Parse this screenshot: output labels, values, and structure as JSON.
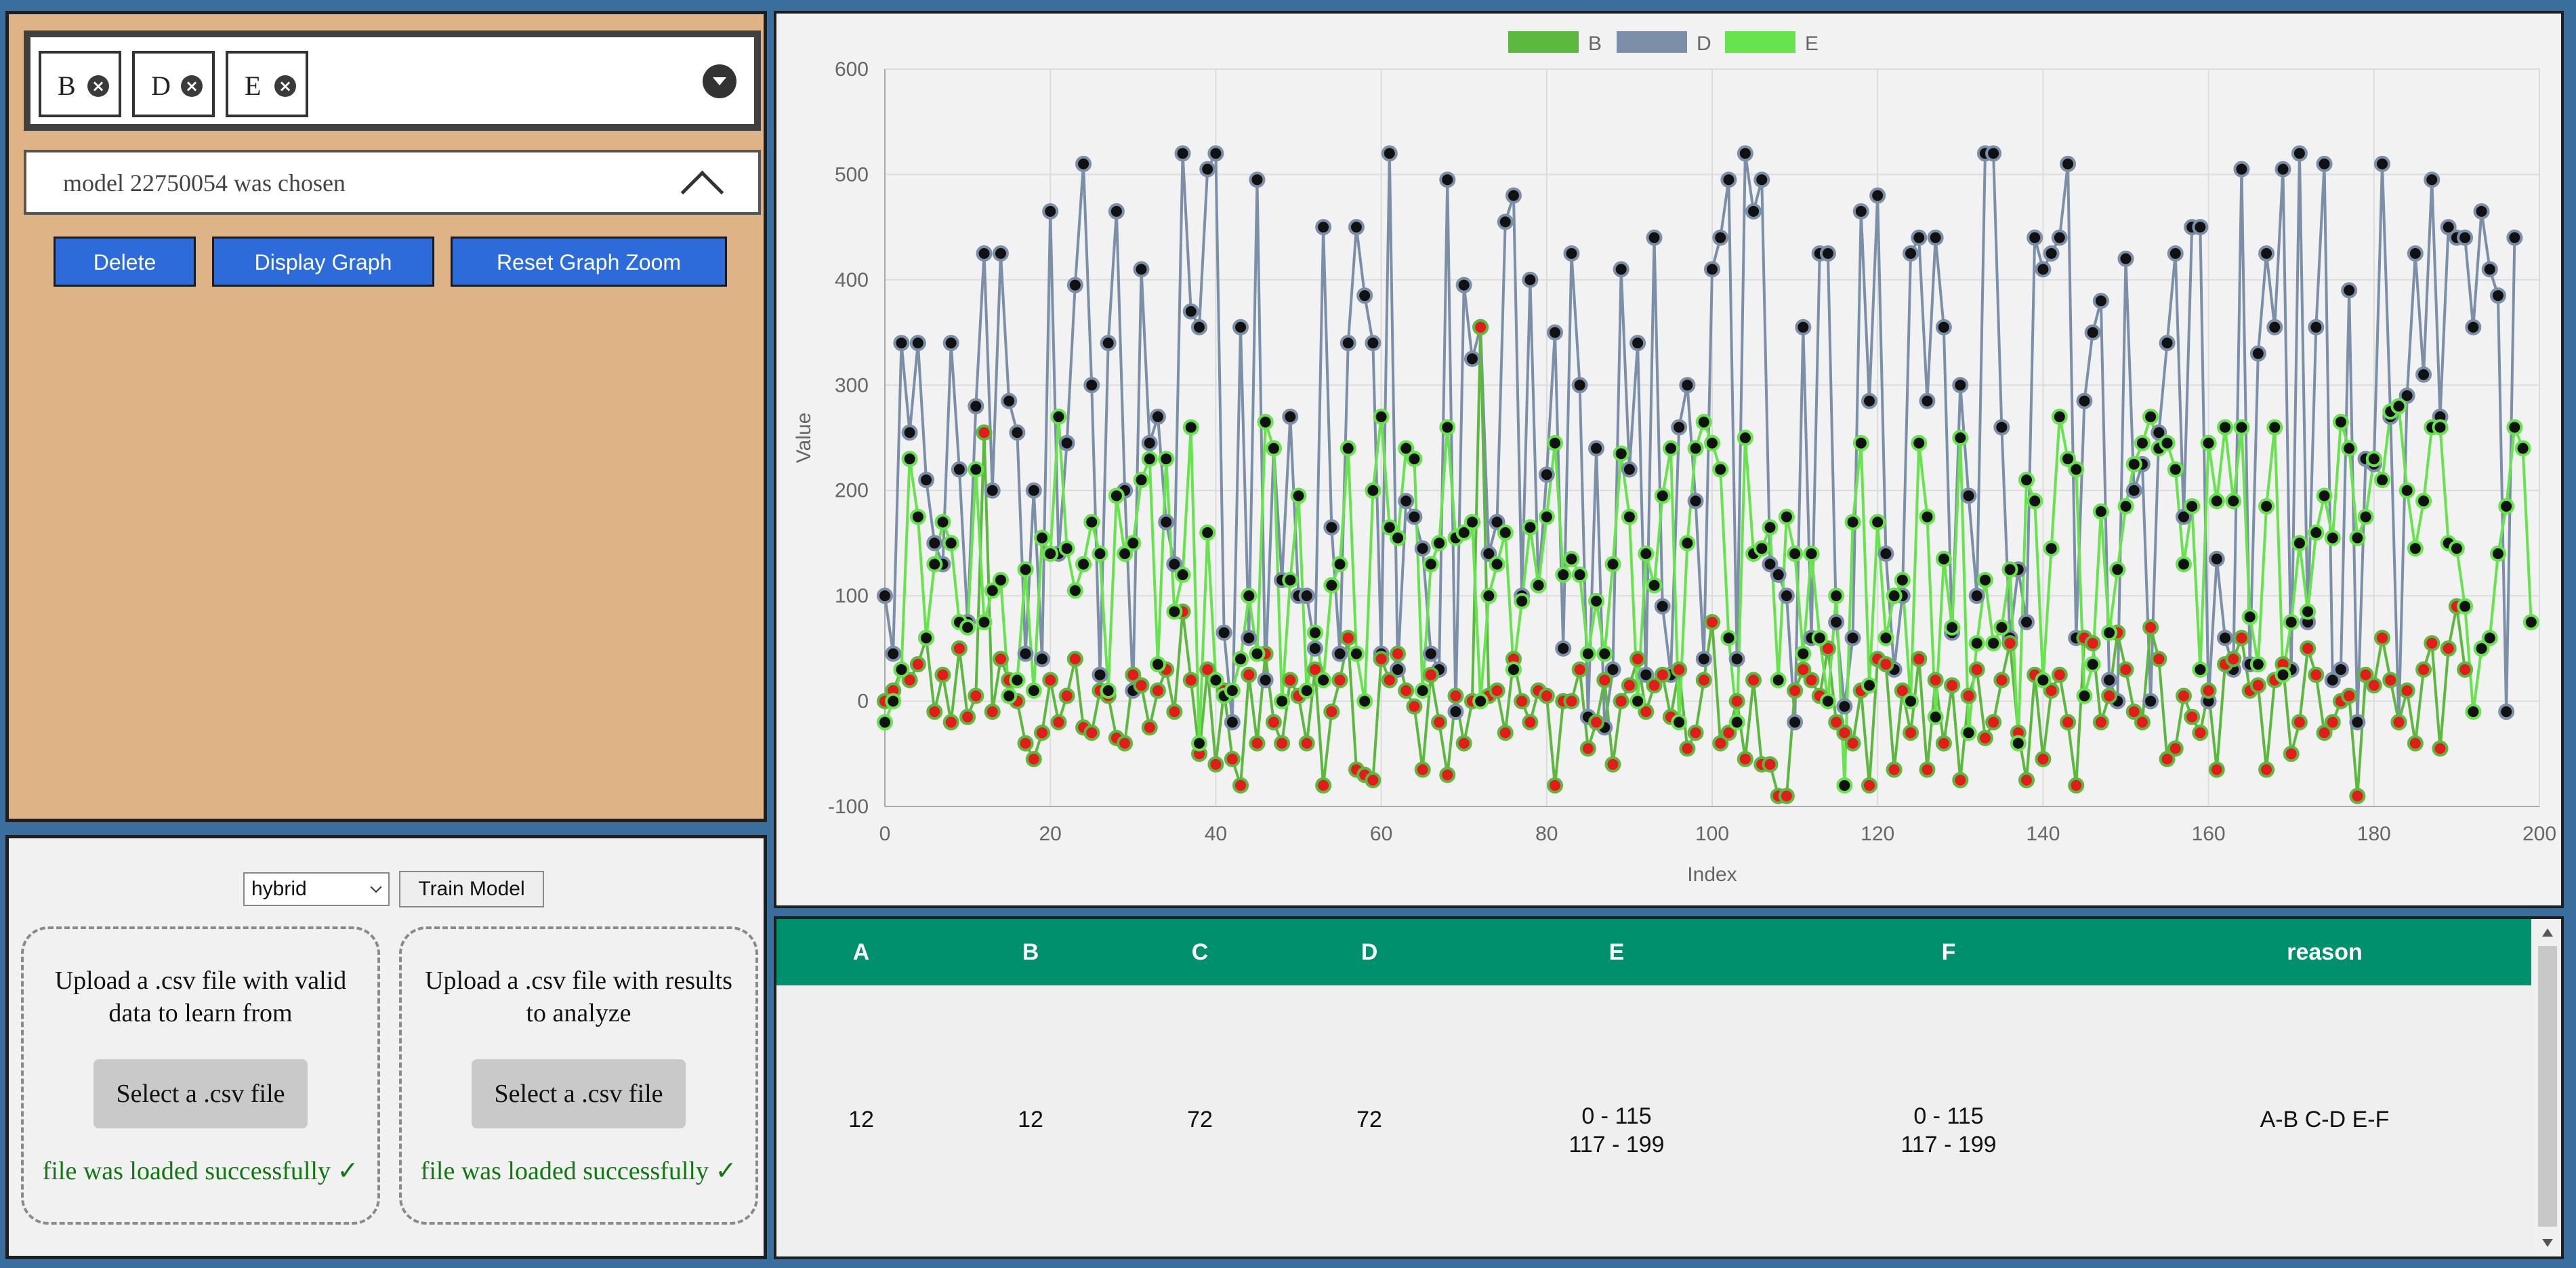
{
  "series_select": {
    "chips": [
      {
        "label": "B"
      },
      {
        "label": "D"
      },
      {
        "label": "E"
      }
    ]
  },
  "model": {
    "status": "model 22750054 was chosen"
  },
  "buttons": {
    "delete": "Delete",
    "display_graph": "Display Graph",
    "reset_zoom": "Reset Graph Zoom"
  },
  "trainer": {
    "model_type": "hybrid",
    "train_label": "Train Model"
  },
  "uploads": [
    {
      "description": "Upload a .csv file with valid data to learn from",
      "button": "Select a .csv file",
      "status": "file was loaded successfully ✓"
    },
    {
      "description": "Upload a .csv file with results to analyze",
      "button": "Select a .csv file",
      "status": "file was loaded successfully ✓"
    }
  ],
  "table": {
    "headers": [
      "A",
      "B",
      "C",
      "D",
      "E",
      "F",
      "reason"
    ],
    "rows": [
      [
        "12",
        "12",
        "72",
        "72",
        "0 - 115\n117 - 199",
        "0 - 115\n117 - 199",
        "A-B C-D E-F"
      ]
    ]
  },
  "chart_data": {
    "type": "line",
    "xlabel": "Index",
    "ylabel": "Value",
    "xlim": [
      0,
      200
    ],
    "ylim": [
      -100,
      600
    ],
    "xticks": [
      0,
      20,
      40,
      60,
      80,
      100,
      120,
      140,
      160,
      180,
      200
    ],
    "yticks": [
      -100,
      0,
      100,
      200,
      300,
      400,
      500,
      600
    ],
    "grid": true,
    "legend_position": "top-center",
    "series": [
      {
        "name": "B",
        "color": "#5cb83f",
        "values": [
          0,
          10,
          30,
          20,
          35,
          60,
          -10,
          25,
          -20,
          50,
          -15,
          5,
          255,
          -10,
          40,
          20,
          0,
          -40,
          -55,
          -30,
          20,
          -20,
          5,
          40,
          -25,
          -30,
          10,
          5,
          -35,
          -40,
          25,
          15,
          -25,
          10,
          30,
          -10,
          85,
          20,
          -50,
          30,
          -60,
          10,
          -55,
          -80,
          25,
          -40,
          45,
          -20,
          -40,
          20,
          5,
          -40,
          30,
          -80,
          -10,
          20,
          60,
          -65,
          -70,
          -75,
          40,
          20,
          45,
          10,
          -5,
          -65,
          25,
          -20,
          -70,
          5,
          -40,
          0,
          355,
          5,
          10,
          -30,
          40,
          0,
          -20,
          10,
          5,
          -80,
          0,
          0,
          30,
          -45,
          -20,
          20,
          -60,
          0,
          15,
          40,
          -10,
          15,
          25,
          -15,
          30,
          -45,
          -30,
          20,
          75,
          -40,
          -30,
          0,
          -55,
          20,
          -60,
          -60,
          -90,
          -90,
          10,
          30,
          20,
          5,
          50,
          -20,
          -30,
          -40,
          10,
          -80,
          40,
          35,
          -65,
          10,
          -30,
          40,
          -65,
          20,
          -40,
          15,
          -75,
          5,
          30,
          -35,
          -20,
          20,
          55,
          -30,
          -75,
          25,
          -55,
          10,
          25,
          -20,
          -80,
          60,
          55,
          -20,
          5,
          65,
          30,
          -10,
          -20,
          70,
          40,
          -55,
          -45,
          5,
          -15,
          -30,
          10,
          -65,
          35,
          40,
          60,
          10,
          15,
          -65,
          20,
          35,
          -50,
          -20,
          50,
          25,
          -30,
          -20,
          0,
          5,
          -90,
          25,
          15,
          60,
          20,
          -20,
          10,
          -40,
          30,
          55,
          -45,
          50,
          90,
          30
        ]
      },
      {
        "name": "D",
        "color": "#7b8fa8",
        "values": [
          100,
          45,
          340,
          255,
          340,
          210,
          150,
          130,
          340,
          220,
          75,
          280,
          425,
          200,
          425,
          285,
          255,
          45,
          200,
          40,
          465,
          140,
          245,
          395,
          510,
          300,
          25,
          340,
          465,
          200,
          10,
          410,
          245,
          270,
          170,
          130,
          520,
          370,
          355,
          505,
          520,
          65,
          -20,
          355,
          60,
          495,
          20,
          240,
          115,
          270,
          100,
          100,
          50,
          450,
          165,
          45,
          340,
          450,
          385,
          340,
          45,
          520,
          30,
          190,
          175,
          145,
          45,
          30,
          495,
          -10,
          395,
          325,
          355,
          140,
          170,
          455,
          480,
          100,
          400,
          110,
          215,
          350,
          50,
          425,
          300,
          -15,
          240,
          -25,
          30,
          410,
          220,
          340,
          25,
          440,
          90,
          25,
          260,
          300,
          190,
          40,
          410,
          440,
          495,
          40,
          520,
          465,
          495,
          130,
          120,
          100,
          -20,
          355,
          60,
          425,
          425,
          75,
          -5,
          60,
          465,
          285,
          480,
          140,
          30,
          100,
          425,
          440,
          285,
          440,
          355,
          65,
          300,
          195,
          100,
          520,
          520,
          260,
          60,
          125,
          75,
          440,
          410,
          425,
          440,
          510,
          60,
          285,
          350,
          380,
          20,
          0,
          420,
          200,
          225,
          0,
          255,
          340,
          425,
          175,
          450,
          450,
          0,
          135,
          60,
          30,
          505,
          35,
          330,
          425,
          355,
          505,
          30,
          520,
          75,
          355,
          510,
          20,
          30,
          390,
          -20,
          230,
          225,
          510,
          270,
          -20,
          290,
          425,
          310,
          495,
          270,
          450,
          440,
          440,
          355,
          465,
          410,
          385,
          -10,
          440
        ]
      },
      {
        "name": "E",
        "color": "#66e34d",
        "values": [
          -20,
          0,
          30,
          230,
          175,
          60,
          130,
          170,
          150,
          75,
          70,
          220,
          75,
          105,
          115,
          5,
          20,
          125,
          10,
          155,
          140,
          270,
          145,
          105,
          130,
          170,
          140,
          10,
          195,
          140,
          150,
          210,
          230,
          35,
          230,
          85,
          120,
          260,
          -40,
          160,
          20,
          5,
          10,
          40,
          100,
          45,
          265,
          240,
          0,
          115,
          195,
          10,
          65,
          20,
          110,
          130,
          240,
          45,
          0,
          200,
          270,
          165,
          155,
          240,
          230,
          10,
          130,
          150,
          260,
          155,
          160,
          170,
          0,
          100,
          130,
          160,
          30,
          95,
          165,
          110,
          175,
          245,
          120,
          135,
          120,
          45,
          95,
          45,
          130,
          235,
          175,
          0,
          140,
          110,
          195,
          240,
          -20,
          150,
          240,
          265,
          245,
          220,
          60,
          -20,
          250,
          140,
          145,
          165,
          20,
          175,
          140,
          45,
          140,
          60,
          0,
          100,
          -80,
          170,
          245,
          15,
          170,
          60,
          100,
          115,
          0,
          245,
          175,
          -15,
          135,
          70,
          250,
          -30,
          55,
          115,
          55,
          70,
          125,
          -40,
          210,
          190,
          20,
          145,
          270,
          230,
          220,
          5,
          35,
          180,
          65,
          125,
          185,
          225,
          245,
          270,
          240,
          245,
          220,
          130,
          185,
          30,
          245,
          190,
          260,
          190,
          260,
          80,
          35,
          185,
          260,
          25,
          75,
          150,
          85,
          160,
          195,
          155,
          265,
          240,
          155,
          175,
          230,
          210,
          275,
          280,
          200,
          145,
          190,
          260,
          260,
          150,
          145,
          90,
          -10,
          50,
          60,
          140,
          185,
          260,
          240,
          75
        ]
      }
    ]
  }
}
